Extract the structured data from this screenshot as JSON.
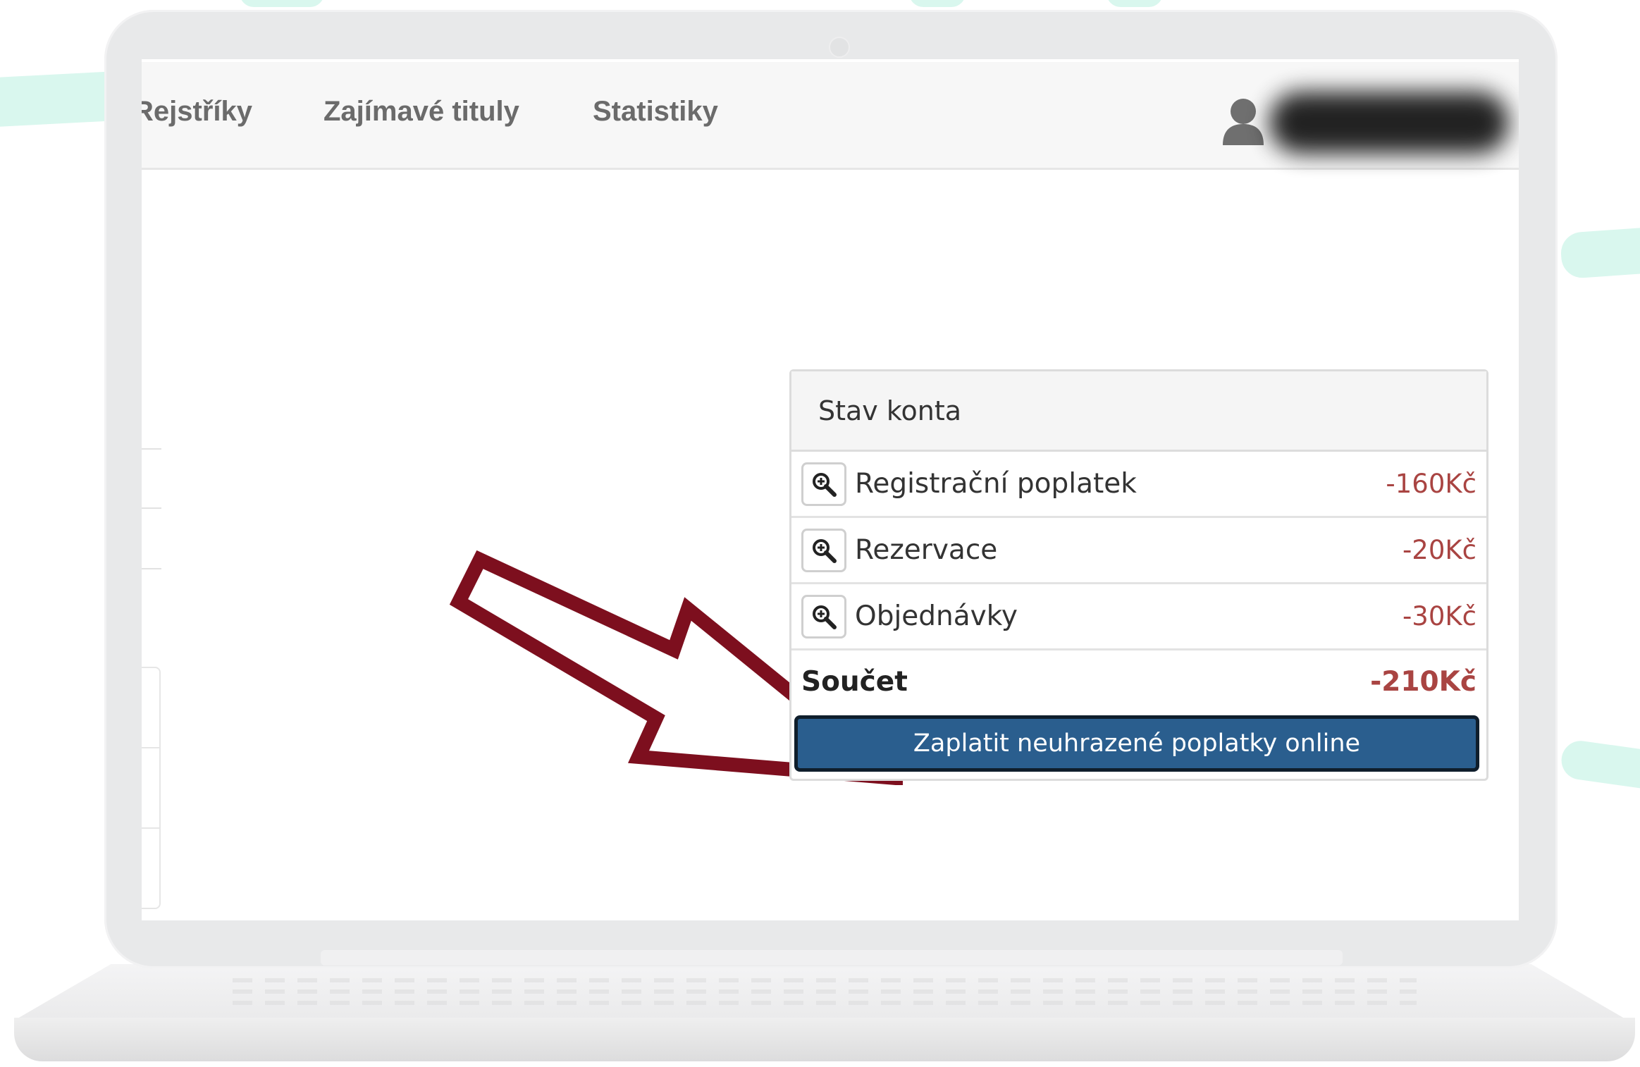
{
  "navbar": {
    "items": [
      {
        "label": "Rejstříky"
      },
      {
        "label": "Zajímavé tituly"
      },
      {
        "label": "Statistiky"
      }
    ]
  },
  "account_panel": {
    "heading": "Stav konta",
    "rows": [
      {
        "label": "Registrační poplatek",
        "amount": "-160Kč"
      },
      {
        "label": "Rezervace",
        "amount": "-20Kč"
      },
      {
        "label": "Objednávky",
        "amount": "-30Kč"
      }
    ],
    "total_label": "Součet",
    "total_amount": "-210Kč",
    "pay_button": "Zaplatit neuhrazené poplatky online"
  },
  "colors": {
    "negative_amount": "#a94442",
    "pay_button": "#2a5e8e",
    "arrow": "#7d0f1e",
    "background_accent": "#d9f7ee"
  },
  "icons": {
    "row_icon": "zoom-in-icon",
    "user": "user-icon",
    "annotation": "arrow-annotation"
  }
}
